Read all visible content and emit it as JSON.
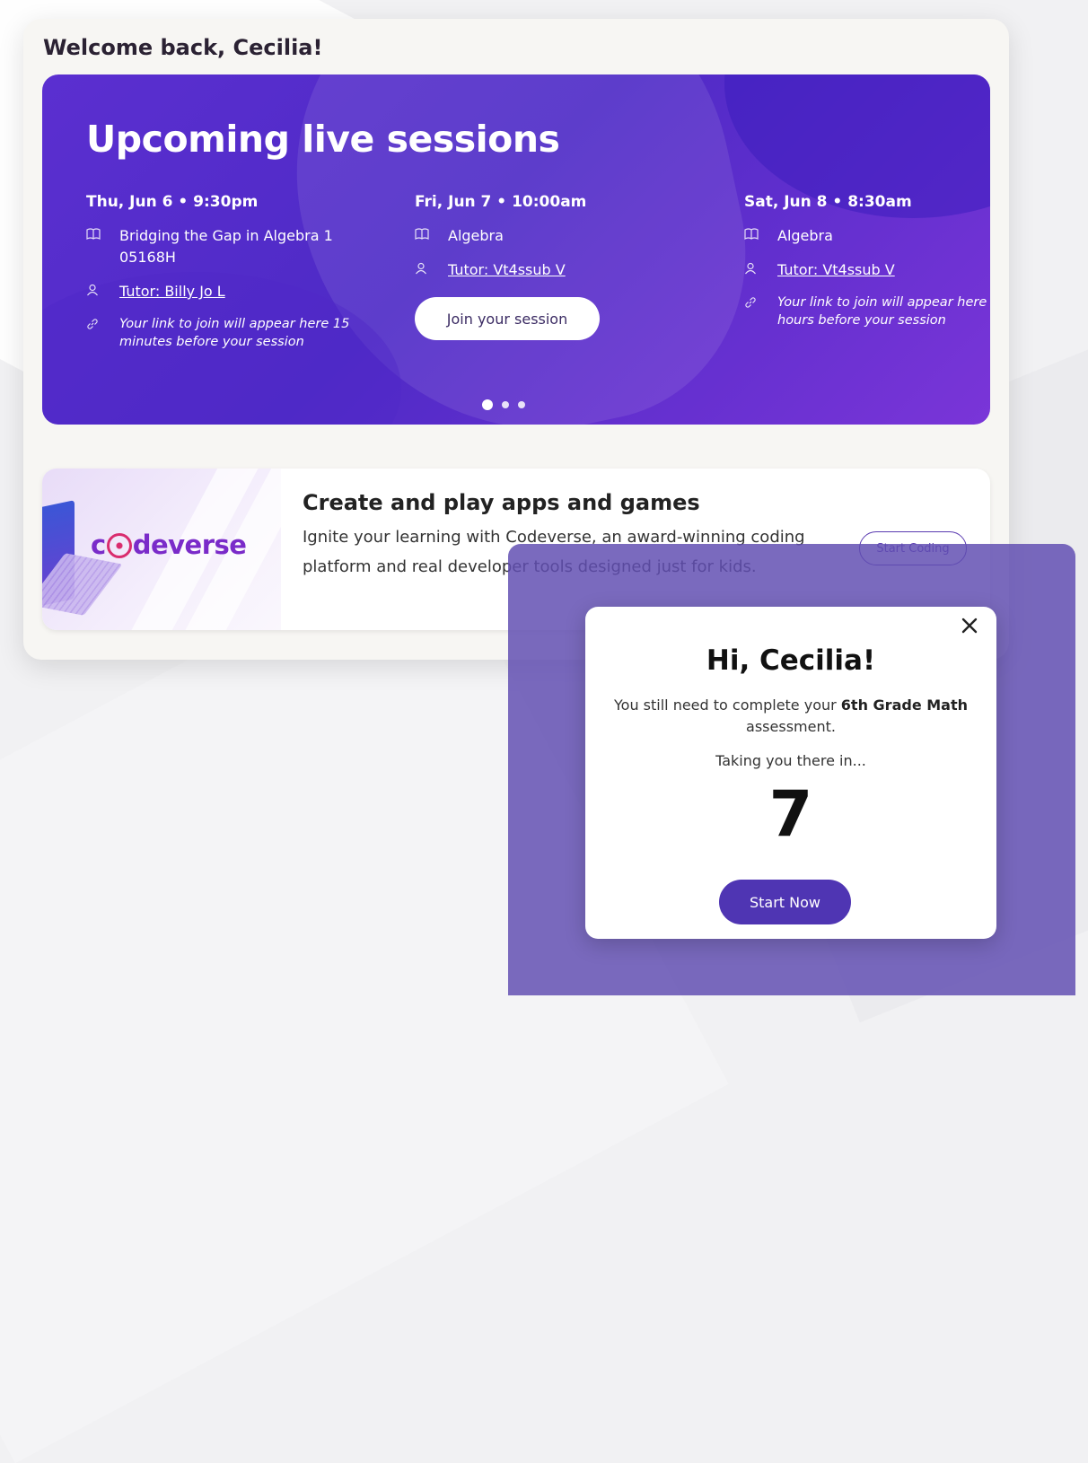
{
  "page": {
    "welcome": "Welcome back, Cecilia!"
  },
  "sessions": {
    "title": "Upcoming live sessions",
    "items": [
      {
        "date": "Thu, Jun 6 • 9:30pm",
        "course": "Bridging the Gap in Algebra 1 05168H",
        "tutor": "Tutor: Billy Jo L",
        "note": "Your link to join will appear here 15 minutes before your session"
      },
      {
        "date": "Fri, Jun 7 • 10:00am",
        "course": "Algebra",
        "tutor": "Tutor: Vt4ssub V",
        "button": "Join your session"
      },
      {
        "date": "Sat, Jun 8 • 8:30am",
        "course": "Algebra",
        "tutor": "Tutor: Vt4ssub V",
        "note": "Your link to join will appear here hours before your session"
      }
    ],
    "pagination": {
      "current": 1,
      "total": 3
    }
  },
  "promo": {
    "logo": "codeverse",
    "title": "Create and play apps and games",
    "description": "Ignite your learning with Codeverse, an award-winning coding platform and real developer tools designed just for kids.",
    "button": "Start Coding"
  },
  "modal": {
    "title": "Hi, Cecilia!",
    "message_before": "You still need to complete your ",
    "message_bold": "6th Grade Math",
    "message_after": " assessment.",
    "taking": "Taking you there in...",
    "countdown": "7",
    "button": "Start Now",
    "close_icon": "close-icon"
  },
  "colors": {
    "sessions_bg": "#5b2fd0",
    "overlay": "#604db2",
    "primary_button": "#4f35b3",
    "codeverse_brand": "#7a2bc9"
  }
}
